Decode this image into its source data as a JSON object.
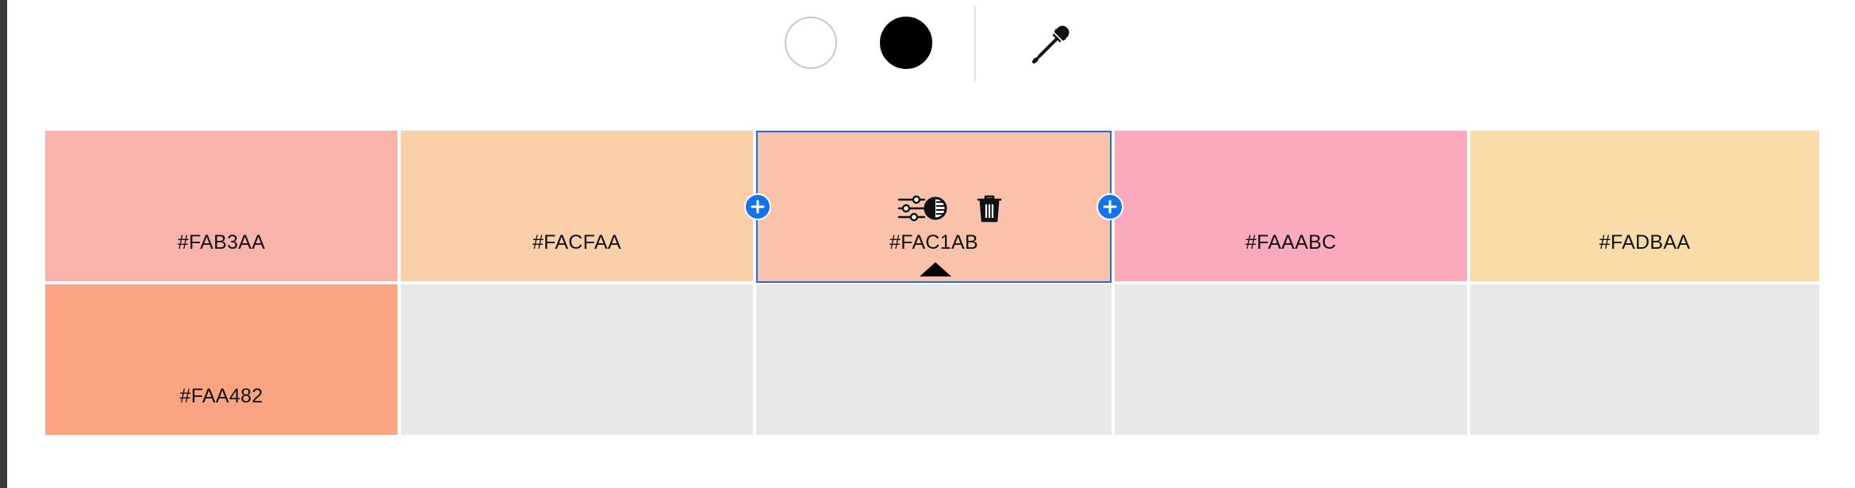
{
  "toolbar": {
    "white_swatch_color": "#FFFFFF",
    "black_swatch_color": "#000000",
    "tools": [
      "color-swatch-white",
      "color-swatch-black",
      "eyedropper-icon"
    ]
  },
  "selected_index": 2,
  "selection_tools": [
    "adjust-sliders-icon",
    "contrast-icon",
    "trash-icon"
  ],
  "swatches": [
    {
      "hex": "#FAB3AA",
      "color": "#FAB3AA"
    },
    {
      "hex": "#FACFAA",
      "color": "#FACFAA"
    },
    {
      "hex": "#FAC1AB",
      "color": "#FAC1AB"
    },
    {
      "hex": "#FAAABC",
      "color": "#FAAABC"
    },
    {
      "hex": "#FADBAA",
      "color": "#FADBAA"
    },
    {
      "hex": "#FAA482",
      "color": "#FAA482"
    }
  ],
  "empty_slot_color": "#E8E8E8",
  "accent_color": "#1473E6"
}
